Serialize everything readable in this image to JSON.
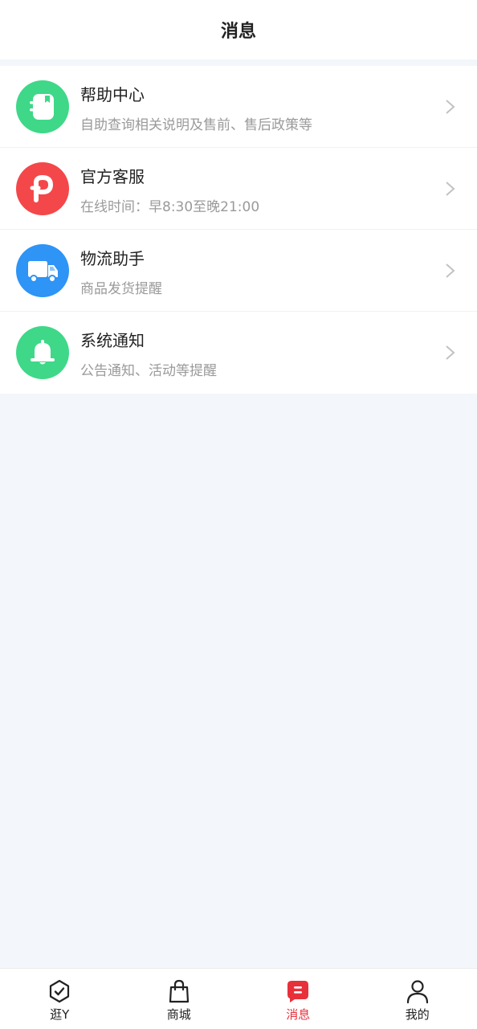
{
  "header": {
    "title": "消息"
  },
  "items": [
    {
      "title": "帮助中心",
      "subtitle": "自助查询相关说明及售前、售后政策等",
      "icon": "help-book-icon",
      "color": "#3ed888"
    },
    {
      "title": "官方客服",
      "subtitle": "在线时间：早8:30至晚21:00",
      "icon": "service-p-icon",
      "color": "#f4474a"
    },
    {
      "title": "物流助手",
      "subtitle": "商品发货提醒",
      "icon": "truck-icon",
      "color": "#2e94f5"
    },
    {
      "title": "系统通知",
      "subtitle": "公告通知、活动等提醒",
      "icon": "bell-icon",
      "color": "#3ed888"
    }
  ],
  "tabbar": {
    "tabs": [
      {
        "label": "逛Y",
        "icon": "hexagon-check-icon",
        "active": false
      },
      {
        "label": "商城",
        "icon": "shopping-bag-icon",
        "active": false
      },
      {
        "label": "消息",
        "icon": "message-icon",
        "active": true
      },
      {
        "label": "我的",
        "icon": "person-icon",
        "active": false
      }
    ],
    "active_color": "#e8303a"
  }
}
